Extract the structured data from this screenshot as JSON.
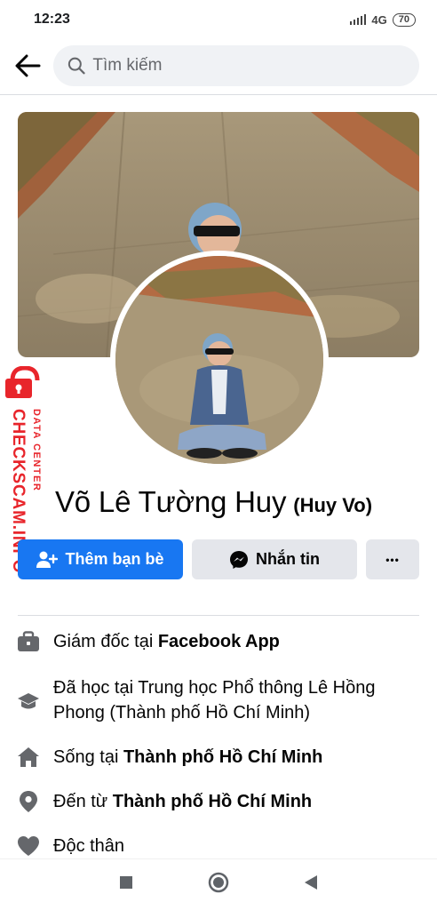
{
  "status_bar": {
    "time": "12:23",
    "network": "4G",
    "battery": "70"
  },
  "search": {
    "placeholder": "Tìm kiếm"
  },
  "profile": {
    "name": "Võ Lê Tường Huy",
    "alternate_name": "(Huy Vo)"
  },
  "actions": {
    "add_friend": "Thêm bạn bè",
    "message": "Nhắn tin",
    "more": "•••"
  },
  "intro": {
    "work_prefix": "Giám đốc tại ",
    "work_place": "Facebook App",
    "education": "Đã học tại Trung học Phổ thông Lê Hồng Phong (Thành phố Hồ Chí Minh)",
    "lives_prefix": "Sống tại ",
    "lives_place": "Thành phố Hồ Chí Minh",
    "from_prefix": "Đến từ ",
    "from_place": "Thành phố Hồ Chí Minh",
    "relationship": "Độc thân"
  },
  "watermark": {
    "line1": "DATA CENTER",
    "line2": "CHECKSCAM.INFO"
  },
  "colors": {
    "primary": "#1877f2",
    "secondary_button": "#e4e6eb",
    "watermark_red": "#e8252b",
    "icon_gray": "#65676b"
  }
}
